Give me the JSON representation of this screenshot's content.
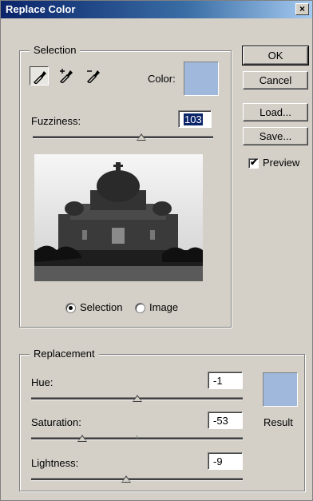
{
  "window": {
    "title": "Replace Color",
    "close_glyph": "×"
  },
  "selection": {
    "legend": "Selection",
    "tools": [
      {
        "name": "eyedropper-icon",
        "active": true
      },
      {
        "name": "eyedropper-plus-icon",
        "active": false
      },
      {
        "name": "eyedropper-minus-icon",
        "active": false
      }
    ],
    "color_label": "Color:",
    "color_swatch": "#a0b8dc",
    "fuzziness_label": "Fuzziness:",
    "fuzziness_value": "103",
    "fuzziness_level": 0.6,
    "view_options": [
      {
        "label": "Selection",
        "checked": true
      },
      {
        "label": "Image",
        "checked": false
      }
    ]
  },
  "buttons": {
    "ok": "OK",
    "cancel": "Cancel",
    "load": "Load...",
    "save": "Save..."
  },
  "preview": {
    "label": "Preview",
    "checked": true,
    "check_glyph": "✔"
  },
  "replacement": {
    "legend": "Replacement",
    "hue_label": "Hue:",
    "hue_value": "-1",
    "hue_level": 0.5,
    "saturation_label": "Saturation:",
    "saturation_value": "-53",
    "saturation_level": 0.24,
    "lightness_label": "Lightness:",
    "lightness_value": "-9",
    "lightness_level": 0.45,
    "result_label": "Result",
    "result_swatch": "#a0b8dc"
  }
}
